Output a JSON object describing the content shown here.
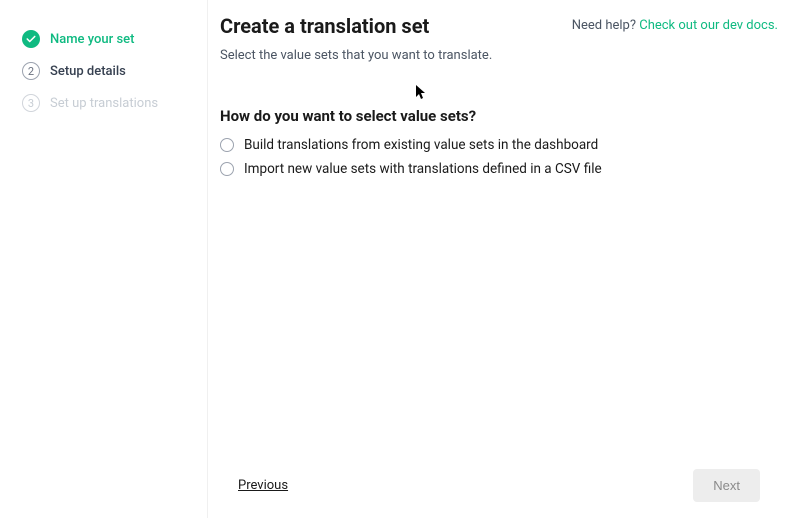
{
  "sidebar": {
    "steps": [
      {
        "label": "Name your set",
        "state": "done"
      },
      {
        "label": "Setup details",
        "state": "current",
        "num": "2"
      },
      {
        "label": "Set up translations",
        "state": "pending",
        "num": "3"
      }
    ]
  },
  "header": {
    "title": "Create a translation set",
    "subtitle": "Select the value sets that you want to translate.",
    "help_text": "Need help? ",
    "help_link": "Check out our dev docs."
  },
  "section": {
    "title": "How do you want to select value sets?",
    "options": [
      "Build translations from existing value sets in the dashboard",
      "Import new value sets with translations defined in a CSV file"
    ]
  },
  "footer": {
    "previous": "Previous",
    "next": "Next"
  }
}
